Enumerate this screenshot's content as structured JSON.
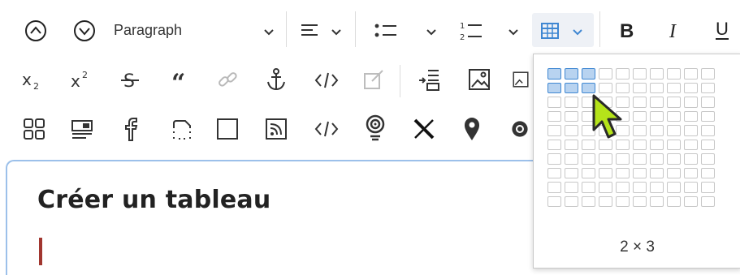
{
  "toolbar": {
    "block_format": "Paragraph",
    "row1_icons": [
      "move-up-icon",
      "move-down-icon",
      "align-left-icon",
      "bullet-list-icon",
      "numbered-list-icon",
      "table-icon",
      "bold-icon",
      "italic-icon",
      "underline-icon"
    ],
    "row2_icons": [
      "subscript-icon",
      "superscript-icon",
      "strikethrough-icon",
      "blockquote-icon",
      "link-icon",
      "anchor-icon",
      "code-icon",
      "edit-icon",
      "insert-line-icon",
      "image-icon",
      "media-icon"
    ],
    "row3_icons": [
      "grid-icon",
      "widget-icon",
      "facebook-icon",
      "snippet-icon",
      "frame-icon",
      "rss-icon",
      "embed-code-icon",
      "podcast-icon",
      "x-icon",
      "map-pin-icon",
      "threads-icon"
    ]
  },
  "editor": {
    "heading": "Créer un tableau"
  },
  "table_picker": {
    "rows": 10,
    "cols": 10,
    "selected_rows": 2,
    "selected_cols": 3,
    "label": "2 × 3"
  },
  "colors": {
    "accent": "#3f87d2",
    "selection_fill": "#b8d3f0",
    "editor_focus_border": "#9cc0ea",
    "caret": "#a1362f",
    "cursor_fill": "#b5e31a"
  }
}
